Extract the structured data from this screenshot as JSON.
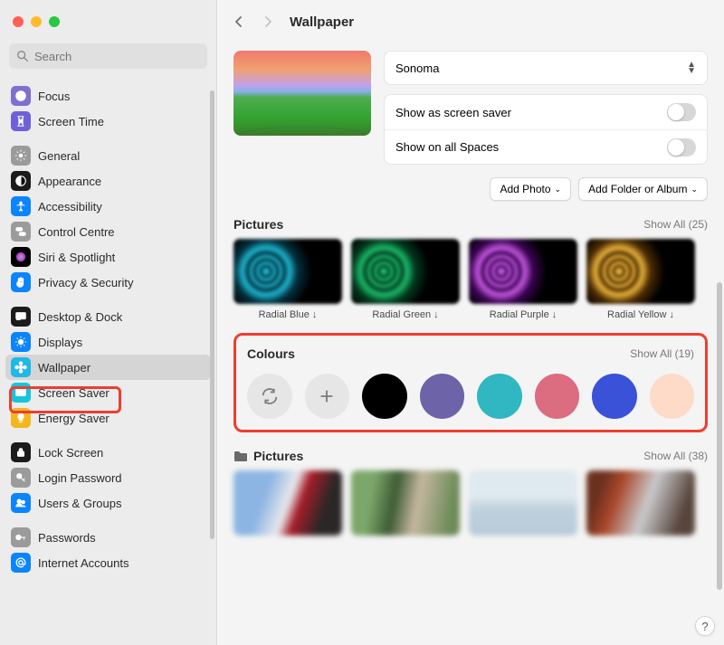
{
  "search": {
    "placeholder": "Search"
  },
  "header": {
    "title": "Wallpaper"
  },
  "sidebar": {
    "groups": [
      [
        {
          "label": "Focus",
          "icon": "moon",
          "bg": "#7e6fd0"
        },
        {
          "label": "Screen Time",
          "icon": "hourglass",
          "bg": "#6e61d8"
        }
      ],
      [
        {
          "label": "General",
          "icon": "gear",
          "bg": "#9b9b9b"
        },
        {
          "label": "Appearance",
          "icon": "appearance",
          "bg": "#1c1c1c"
        },
        {
          "label": "Accessibility",
          "icon": "accessibility",
          "bg": "#0a84ff"
        },
        {
          "label": "Control Centre",
          "icon": "switches",
          "bg": "#9b9b9b"
        },
        {
          "label": "Siri & Spotlight",
          "icon": "siri",
          "bg": "#000000"
        },
        {
          "label": "Privacy & Security",
          "icon": "hand",
          "bg": "#0a84ff"
        }
      ],
      [
        {
          "label": "Desktop & Dock",
          "icon": "desktop",
          "bg": "#1c1c1c"
        },
        {
          "label": "Displays",
          "icon": "sun",
          "bg": "#0a84ff"
        },
        {
          "label": "Wallpaper",
          "icon": "flower",
          "bg": "#1fb8e8",
          "selected": true
        },
        {
          "label": "Screen Saver",
          "icon": "screensaver",
          "bg": "#15c5dc"
        },
        {
          "label": "Energy Saver",
          "icon": "bulb",
          "bg": "#f3b71e"
        }
      ],
      [
        {
          "label": "Lock Screen",
          "icon": "lock",
          "bg": "#1c1c1c"
        },
        {
          "label": "Login Password",
          "icon": "key-badge",
          "bg": "#9b9b9b"
        },
        {
          "label": "Users & Groups",
          "icon": "users",
          "bg": "#0a84ff"
        }
      ],
      [
        {
          "label": "Passwords",
          "icon": "key",
          "bg": "#9b9b9b"
        },
        {
          "label": "Internet Accounts",
          "icon": "at",
          "bg": "#0a84ff"
        }
      ]
    ]
  },
  "wallpaper": {
    "current_name": "Sonoma",
    "toggles": [
      {
        "label": "Show as screen saver"
      },
      {
        "label": "Show on all Spaces"
      }
    ],
    "buttons": {
      "add_photo": "Add Photo",
      "add_folder": "Add Folder or Album"
    }
  },
  "sections": {
    "pictures": {
      "title": "Pictures",
      "show_all": "Show All (25)",
      "items": [
        {
          "label": "Radial Blue ↓",
          "class": "rad-blue"
        },
        {
          "label": "Radial Green ↓",
          "class": "rad-green"
        },
        {
          "label": "Radial Purple ↓",
          "class": "rad-purple"
        },
        {
          "label": "Radial Yellow ↓",
          "class": "rad-yellow"
        }
      ]
    },
    "colours": {
      "title": "Colours",
      "show_all": "Show All (19)",
      "swatches": [
        "#000000",
        "#6d63a9",
        "#31b7c1",
        "#dc6c80",
        "#3a52d8",
        "#fedbc8"
      ]
    },
    "user_pictures": {
      "title": "Pictures",
      "show_all": "Show All (38)"
    }
  },
  "help": "?"
}
